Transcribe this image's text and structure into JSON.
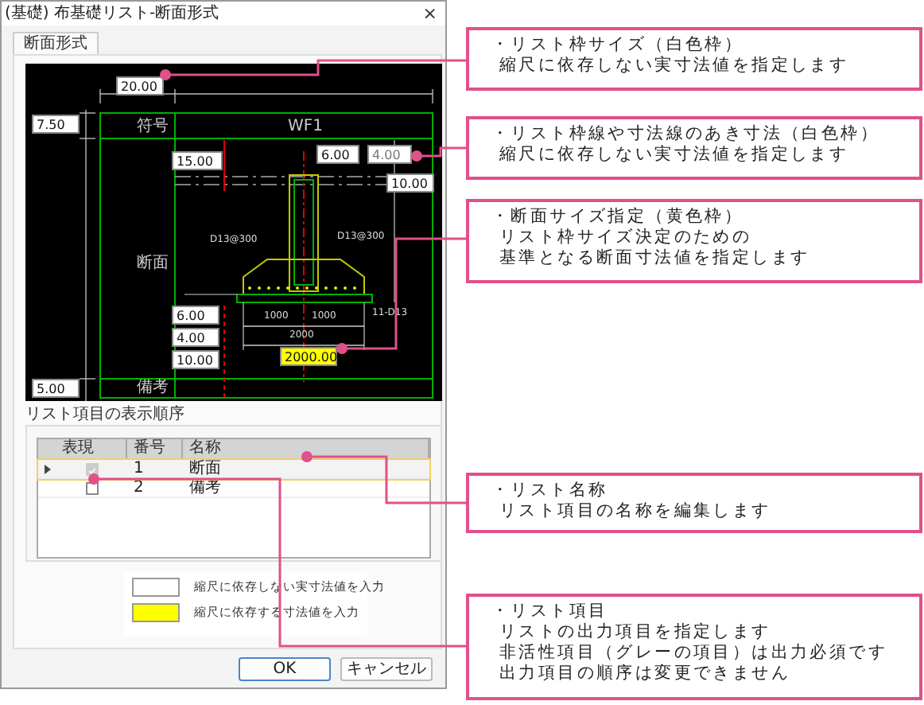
{
  "window": {
    "title": "(基礎) 布基礎リスト-断面形式",
    "close": "×"
  },
  "tabs": [
    {
      "label": "断面形式",
      "selected": true
    }
  ],
  "canvas": {
    "labels": [
      "符号",
      "WF1",
      "断面",
      "備考"
    ],
    "dimension_labels": [
      "1000",
      "1000",
      "2000",
      "D13@300",
      "D13@300",
      "11-D13"
    ],
    "fields": [
      {
        "value": "20.00",
        "kind": "fixed",
        "disabled": false
      },
      {
        "value": "7.50",
        "kind": "fixed",
        "disabled": false
      },
      {
        "value": "15.00",
        "kind": "fixed",
        "disabled": false
      },
      {
        "value": "6.00",
        "kind": "fixed",
        "disabled": false
      },
      {
        "value": "4.00",
        "kind": "fixed",
        "disabled": true
      },
      {
        "value": "10.00",
        "kind": "fixed",
        "disabled": false
      },
      {
        "value": "6.00",
        "kind": "fixed",
        "disabled": false
      },
      {
        "value": "4.00",
        "kind": "fixed",
        "disabled": false
      },
      {
        "value": "10.00",
        "kind": "fixed",
        "disabled": false
      },
      {
        "value": "2000.00",
        "kind": "scaled",
        "disabled": false
      },
      {
        "value": "5.00",
        "kind": "fixed",
        "disabled": false
      }
    ]
  },
  "list_order": {
    "title": "リスト項目の表示順序",
    "columns": [
      "表現",
      "番号",
      "名称"
    ],
    "rows": [
      {
        "selected": true,
        "checked": true,
        "disabled": true,
        "number": "1",
        "name": "断面"
      },
      {
        "selected": false,
        "checked": false,
        "disabled": false,
        "number": "2",
        "name": "備考"
      }
    ]
  },
  "legend": [
    {
      "kind": "fixed",
      "label": "縮尺に依存しない実寸法値を入力"
    },
    {
      "kind": "scaled",
      "label": "縮尺に依存する寸法値を入力"
    }
  ],
  "buttons": [
    {
      "label": "OK",
      "default": true
    },
    {
      "label": "キャンセル",
      "default": false
    }
  ],
  "callouts": [
    {
      "lines": [
        "・リスト枠サイズ（白色枠）",
        "縮尺に依存しない実寸法値を指定します"
      ]
    },
    {
      "lines": [
        "・リスト枠線や寸法線のあき寸法（白色枠）",
        "縮尺に依存しない実寸法値を指定します"
      ]
    },
    {
      "lines": [
        "・断面サイズ指定（黄色枠）",
        "リスト枠サイズ決定のための",
        "基準となる断面寸法値を指定します"
      ]
    },
    {
      "lines": [
        "・リスト名称",
        "リスト項目の名称を編集します"
      ]
    },
    {
      "lines": [
        "・リスト項目",
        "リストの出力項目を指定します",
        "非活性項目（グレーの項目）は出力必須です",
        "出力項目の順序は変更できません"
      ]
    }
  ]
}
